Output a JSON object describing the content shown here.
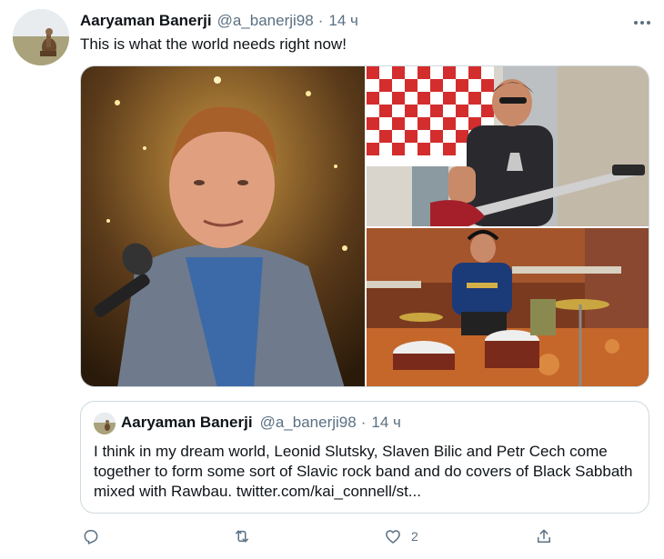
{
  "tweet": {
    "author_name": "Aaryaman Banerji",
    "handle": "@a_banerji98",
    "separator": "·",
    "time": "14 ч",
    "more_icon": "more-horizontal-icon",
    "text": "This is what the world needs right now!"
  },
  "media": {
    "photos": [
      {
        "icon": "photo-singer-microphone"
      },
      {
        "icon": "photo-guitarist"
      },
      {
        "icon": "photo-drummer"
      }
    ]
  },
  "quote": {
    "author_name": "Aaryaman Banerji",
    "handle": "@a_banerji98",
    "separator": "·",
    "time": "14 ч",
    "text": "I think in my dream world, Leonid Slutsky, Slaven Bilic and Petr Cech come together to form some sort of Slavic rock band and do covers of Black Sabbath mixed with Rawbau. twitter.com/kai_connell/st..."
  },
  "actions": {
    "reply_icon": "reply-icon",
    "retweet_icon": "retweet-icon",
    "like_icon": "heart-icon",
    "like_count": "2",
    "share_icon": "share-icon"
  },
  "colors": {
    "text": "#0f1419",
    "secondary": "#5b7083",
    "border": "#cfd9de"
  }
}
